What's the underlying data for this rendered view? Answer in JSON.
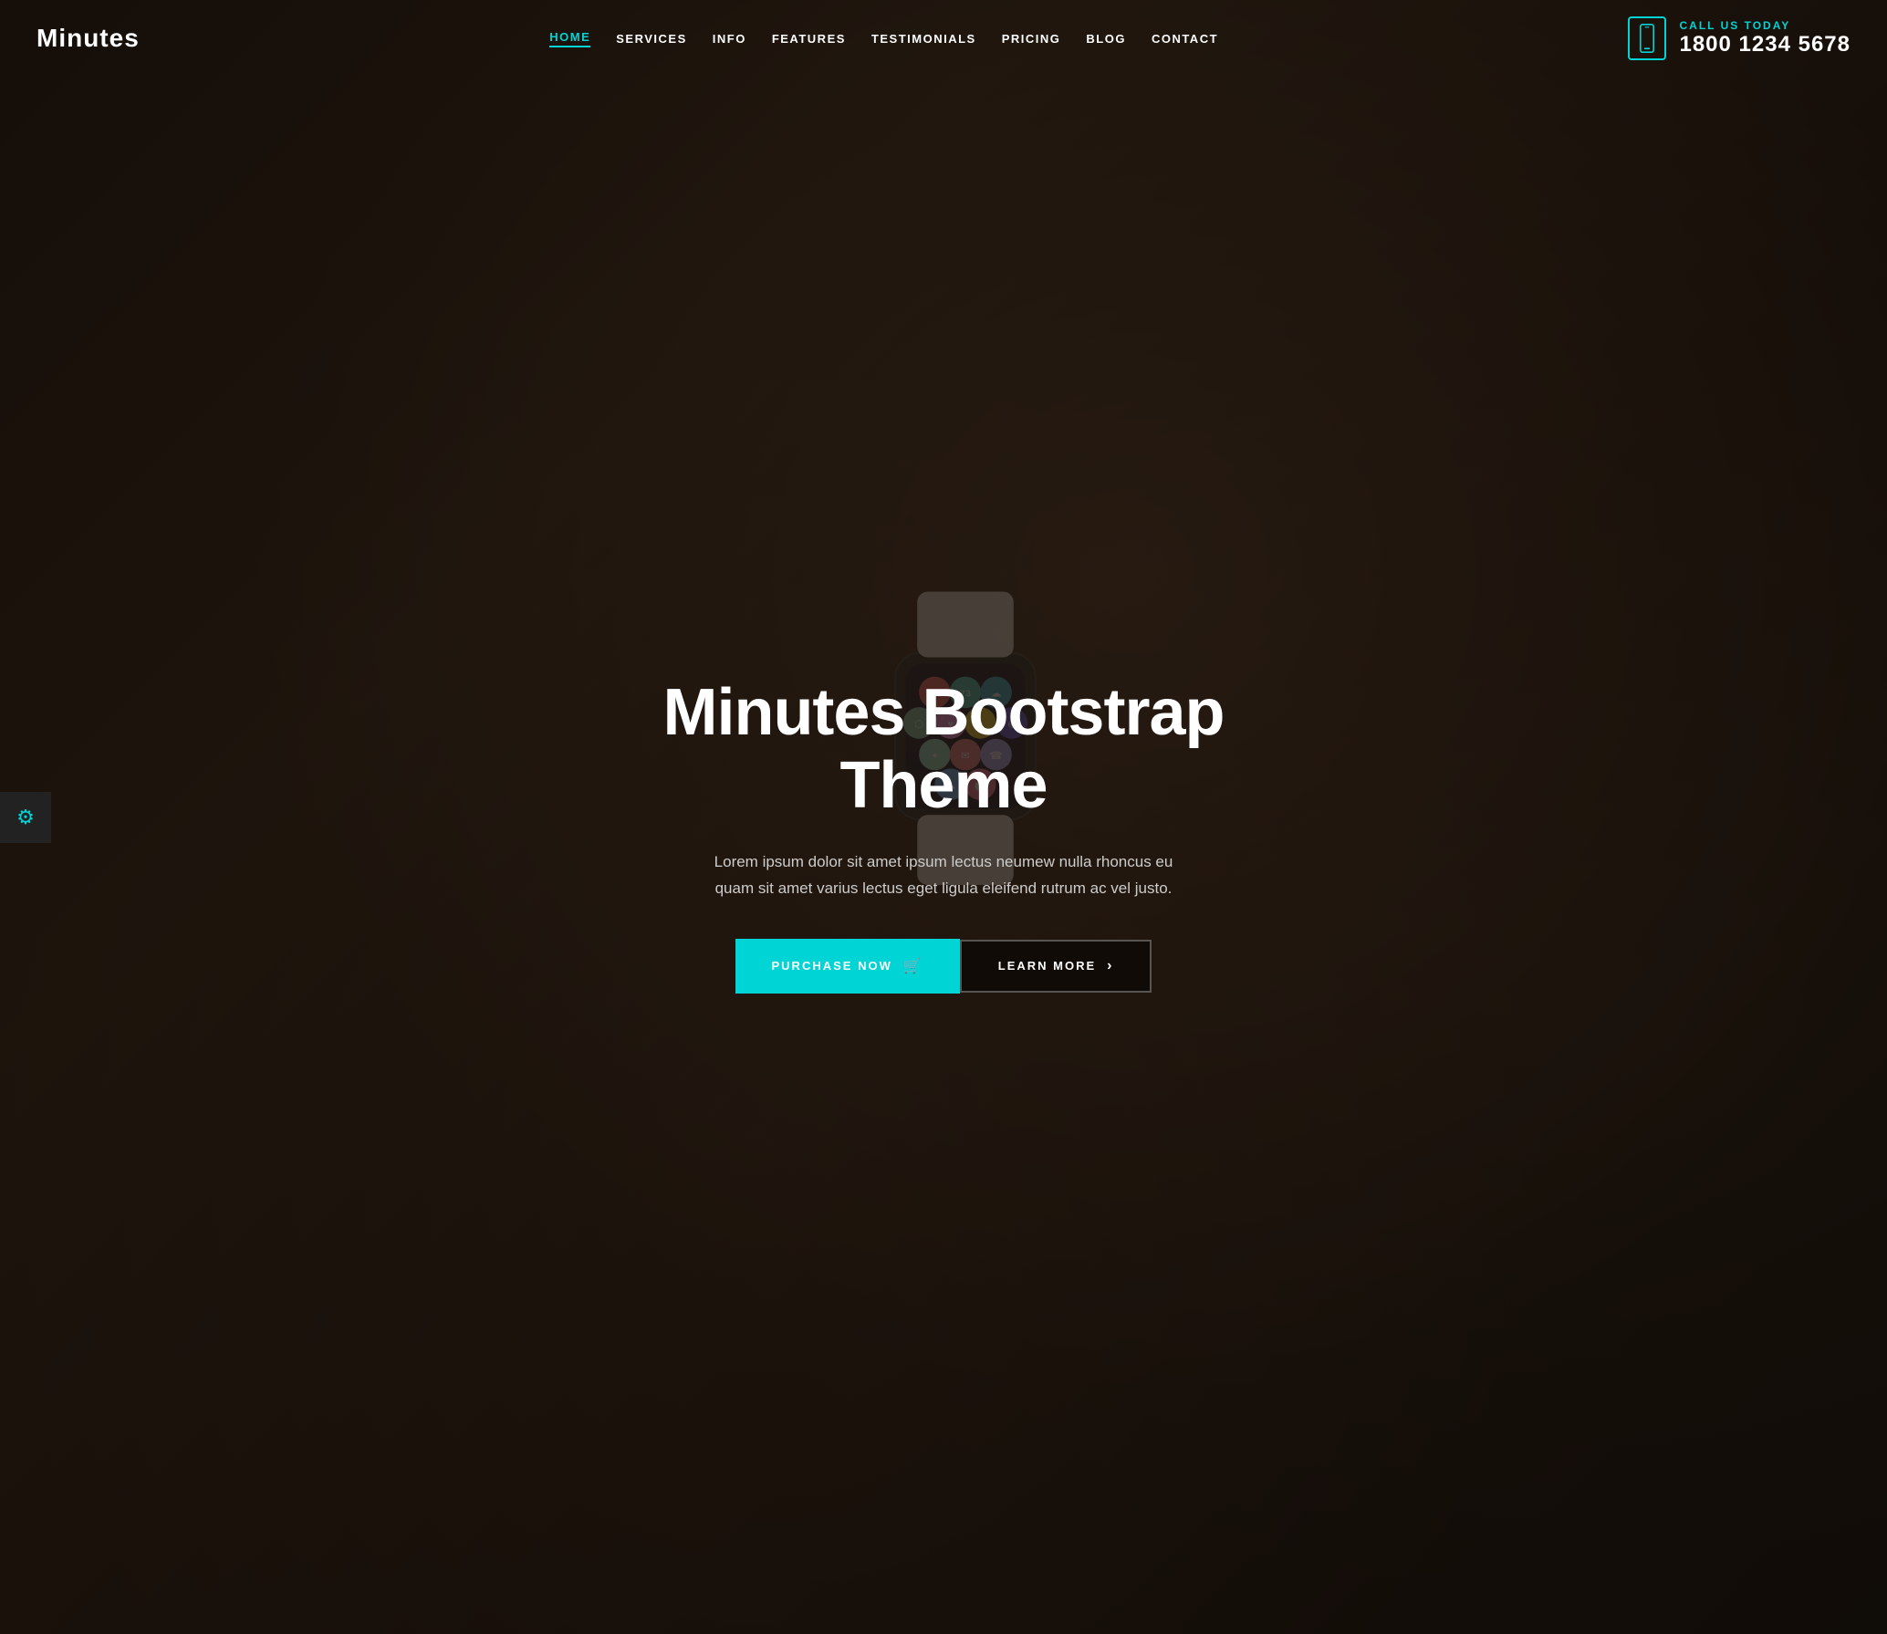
{
  "header": {
    "logo": "Minutes",
    "nav": {
      "items": [
        {
          "label": "HOME",
          "active": true
        },
        {
          "label": "SERVICES",
          "active": false
        },
        {
          "label": "INFO",
          "active": false
        },
        {
          "label": "FEATURES",
          "active": false
        },
        {
          "label": "TESTIMONIALS",
          "active": false
        },
        {
          "label": "PRICING",
          "active": false
        },
        {
          "label": "BLOG",
          "active": false
        },
        {
          "label": "CONTACT",
          "active": false
        }
      ]
    },
    "call_us_label": "CALL US TODAY",
    "phone_number": "1800 1234 5678"
  },
  "hero": {
    "title": "Minutes Bootstrap Theme",
    "description": "Lorem ipsum dolor sit amet ipsum lectus neumew nulla rhoncus eu quam sit amet varius lectus eget ligula eleifend rutrum ac vel justo.",
    "btn_purchase_label": "PURCHASE NOW",
    "btn_learn_label": "LEARN MORE"
  },
  "settings": {
    "icon_label": "⚙"
  },
  "colors": {
    "accent": "#00d4d4",
    "dark_bg": "#1a0e08",
    "text_light": "#ffffff"
  }
}
